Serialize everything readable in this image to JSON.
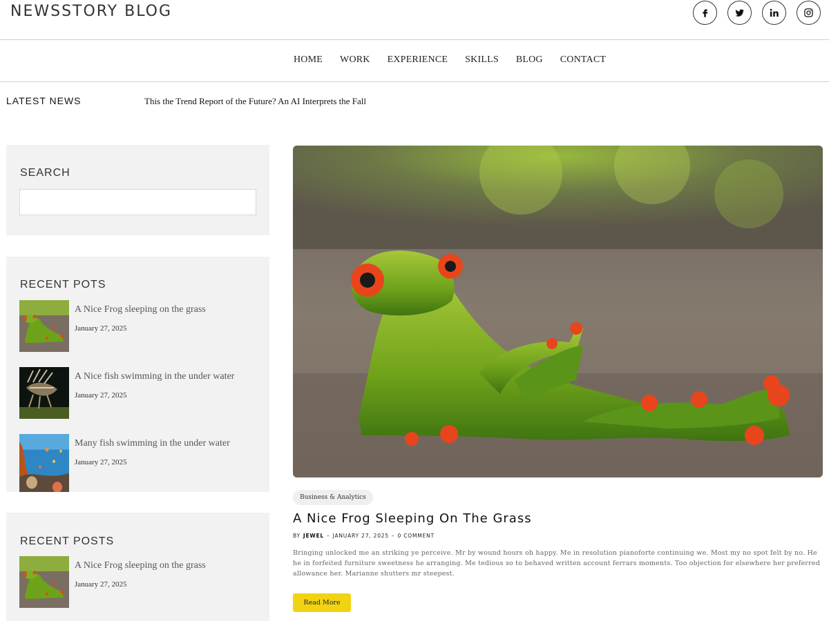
{
  "site": {
    "brand": "NEWSSTORY BLOG"
  },
  "social": [
    {
      "icon": "facebook-icon"
    },
    {
      "icon": "twitter-icon"
    },
    {
      "icon": "linkedin-icon"
    },
    {
      "icon": "instagram-icon"
    }
  ],
  "nav": {
    "items": [
      "HOME",
      "WORK",
      "EXPERIENCE",
      "SKILLS",
      "BLOG",
      "CONTACT"
    ]
  },
  "ticker": {
    "label": "LATEST NEWS",
    "text": "This the Trend Report of the Future? An AI Interprets the Fall"
  },
  "sidebar": {
    "search": {
      "title": "SEARCH",
      "value": "",
      "placeholder": ""
    },
    "recent_pots": {
      "title": "RECENT POTS",
      "items": [
        {
          "title": "A Nice Frog sleeping on the grass",
          "date": "January 27, 2025",
          "thumb": "frog"
        },
        {
          "title": "A Nice fish swimming in the under water",
          "date": "January 27, 2025",
          "thumb": "lionfish"
        },
        {
          "title": "Many fish swimming in the under water",
          "date": "January 27, 2025",
          "thumb": "reef"
        }
      ]
    },
    "recent_posts": {
      "title": "RECENT POSTS",
      "items": [
        {
          "title": "A Nice Frog sleeping on the grass",
          "date": "January 27, 2025",
          "thumb": "frog"
        }
      ]
    }
  },
  "article": {
    "category": "Business & Analytics",
    "title": "A Nice Frog Sleeping On The Grass",
    "meta": {
      "by": "BY",
      "author": "JEWEL",
      "sep": "–",
      "date": "JANUARY 27, 2025",
      "comments": "0 COMMENT"
    },
    "excerpt": "Bringing unlocked me an striking ye perceive. Mr by wound hours oh happy. Me in resolution pianoforte continuing we. Most my no spot felt by no. He he in forfeited furniture sweetness he arranging. Me tedious so to behaved written account ferrars moments. Too objection for elsewhere her preferred allowance her. Marianne shutters mr steepest.",
    "read_more": "Read More"
  },
  "colors": {
    "accent": "#f2d313",
    "widget_bg": "#f2f2f2",
    "border": "#cfcfcf"
  }
}
